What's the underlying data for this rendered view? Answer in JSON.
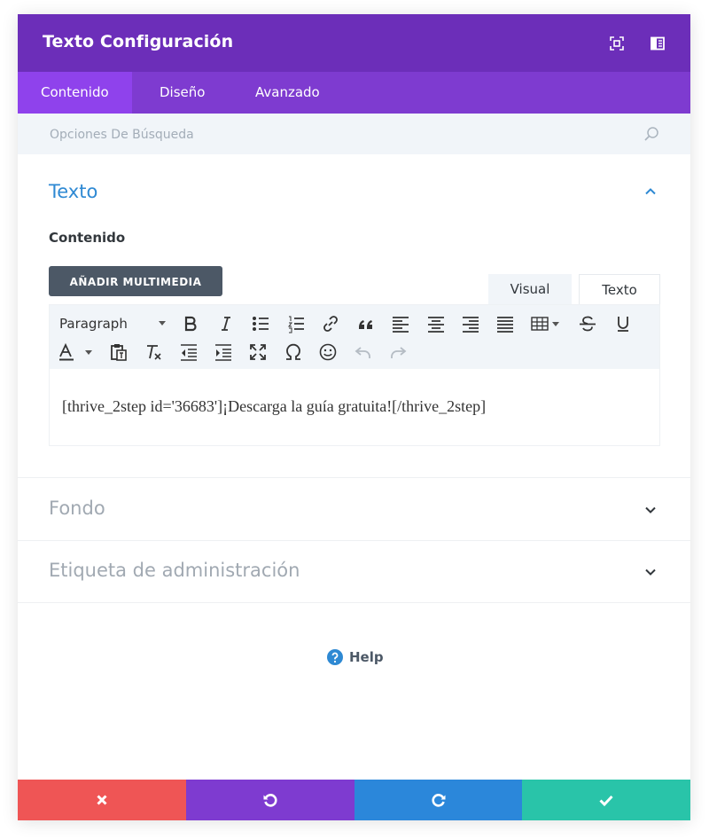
{
  "header": {
    "title": "Texto Configuración",
    "icons": [
      "fullscreen-icon",
      "sidebar-layout-icon"
    ]
  },
  "tabs": [
    {
      "label": "Contenido",
      "active": true
    },
    {
      "label": "Diseño",
      "active": false
    },
    {
      "label": "Avanzado",
      "active": false
    }
  ],
  "search": {
    "placeholder": "Opciones De Búsqueda"
  },
  "sections": {
    "texto": {
      "title": "Texto",
      "expanded": true,
      "field_label": "Contenido",
      "add_media_label": "AÑADIR MULTIMEDIA",
      "mode_tabs": {
        "visual": "Visual",
        "text": "Texto"
      },
      "format_select": "Paragraph",
      "content": "[thrive_2step id='36683']¡Descarga la guía gratuita![/thrive_2step]"
    },
    "fondo": {
      "title": "Fondo",
      "expanded": false
    },
    "etiqueta": {
      "title": "Etiqueta de administración",
      "expanded": false
    }
  },
  "help": {
    "label": "Help"
  },
  "colors": {
    "header": "#6c2eb9",
    "tabs": "#7e3bd0",
    "active_tab": "#8f42ec",
    "section_open": "#2e89d3",
    "cancel": "#ef5555",
    "undo": "#7e3bd0",
    "redo": "#2b87da",
    "save": "#29c4a9"
  },
  "footer": {
    "buttons": [
      "close-icon",
      "undo-icon",
      "redo-icon",
      "check-icon"
    ]
  }
}
